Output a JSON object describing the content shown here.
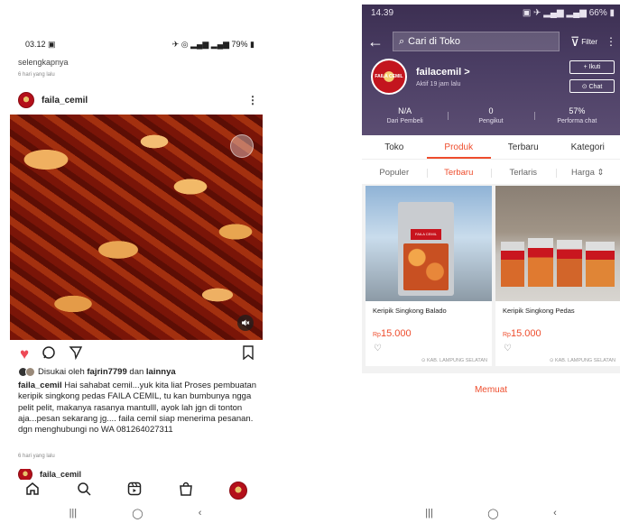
{
  "instagram": {
    "status": {
      "time": "03.12",
      "image_icon": "▣",
      "right": "79%"
    },
    "prev_post": {
      "text": "selengkapnya",
      "time": "6 hari yang lalu"
    },
    "post": {
      "username": "faila_cemil",
      "more_icon": "⋮",
      "mute_icon": "volume-off-icon",
      "likes_prefix": "Disukai oleh",
      "likes_user": "fajrin7799",
      "likes_and": "dan",
      "likes_others": "lainnya",
      "caption_user": "faila_cemil",
      "caption_text": "Hai sahabat cemil...yuk kita liat Proses pembuatan keripik singkong pedas FAILA CEMIL, tu kan bumbunya ngga pelit pelit, makanya rasanya mantulll, ayok lah jgn di tonton aja...pesan sekarang jg.... faila cemil siap menerima pesanan. dgn menghubungi no WA 081264027311",
      "time": "6 hari yang lalu"
    },
    "next_post": {
      "username": "faila_cemil"
    },
    "actions": {
      "like": "♥",
      "comment": "◯",
      "share": "▽",
      "save": "⛉"
    },
    "nav": {
      "home": "⌂",
      "search": "⌕",
      "reels": "▣",
      "shop": "⛀"
    },
    "sys_nav": {
      "recent": "|||",
      "home": "◯",
      "back": "‹"
    }
  },
  "shopee": {
    "status": {
      "time": "14.39",
      "right": "66%"
    },
    "search_placeholder": "Cari di Toko",
    "back_icon": "←",
    "search_icon": "⌕",
    "filter_label": "Filter",
    "filter_icon": "⊽",
    "more_icon": "⋮",
    "shop": {
      "logo_text": "FAILA CEMIL",
      "name": "failacemil >",
      "active": "Aktif 19 jam lalu",
      "follow_button": "+ Ikuti",
      "chat_button": "⊙ Chat"
    },
    "stats": [
      {
        "value": "N/A",
        "label": "Dari Pembeli"
      },
      {
        "value": "0",
        "label": "Pengikut"
      },
      {
        "value": "57%",
        "label": "Performa chat"
      }
    ],
    "tabs": [
      "Toko",
      "Produk",
      "Terbaru",
      "Kategori"
    ],
    "subtabs": [
      "Populer",
      "Terbaru",
      "Terlaris",
      "Harga ⇕"
    ],
    "products": [
      {
        "name": "Keripik Singkong Balado",
        "currency": "Rp",
        "price": "15.000",
        "heart": "♡",
        "location": "⊙ KAB. LAMPUNG SELATAN",
        "pack_label": "FAILA CEMIL"
      },
      {
        "name": "Keripik Singkong Pedas",
        "currency": "Rp",
        "price": "15.000",
        "heart": "♡",
        "location": "⊙ KAB. LAMPUNG SELATAN"
      }
    ],
    "loading_text": "Memuat",
    "sys_nav": {
      "recent": "|||",
      "home": "◯",
      "back": "‹"
    },
    "colors": {
      "accent": "#ee4d2d",
      "header": "#4a3d63"
    }
  }
}
